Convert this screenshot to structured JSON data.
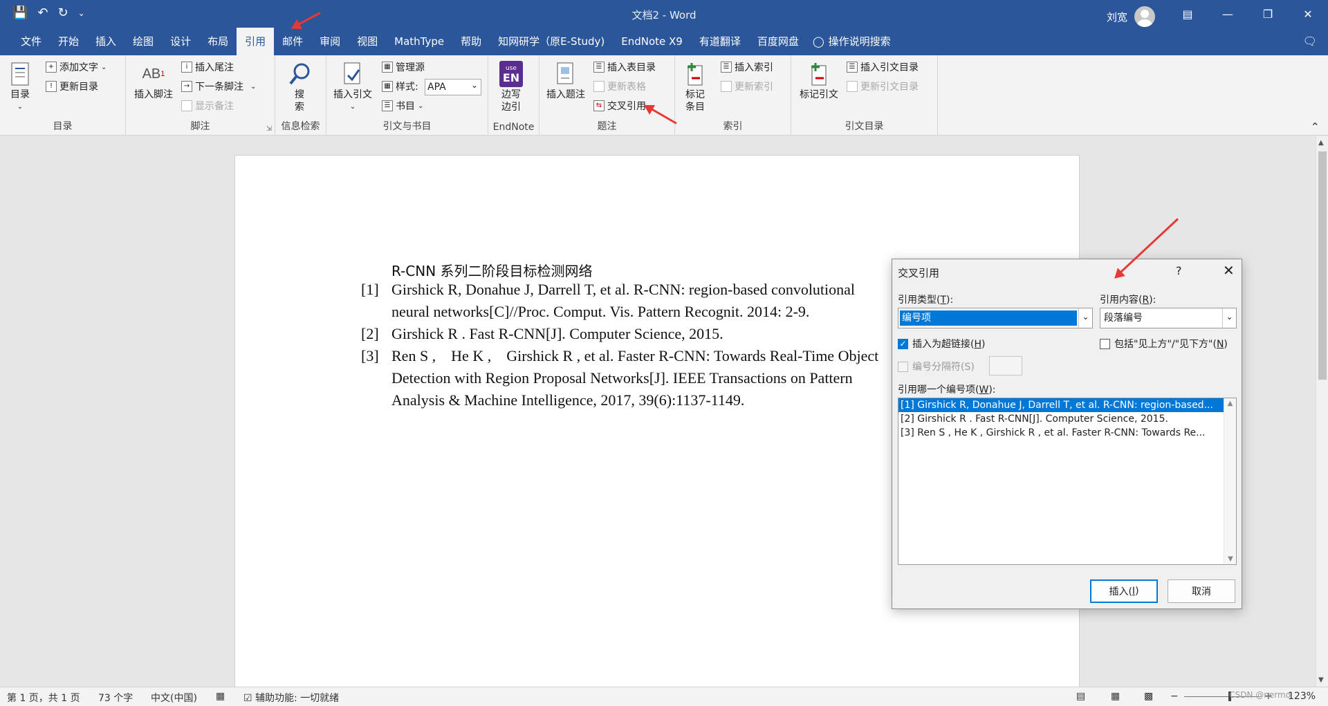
{
  "title": {
    "doc_name": "文档2",
    "sep": " - ",
    "app": "Word",
    "user": "刘宽"
  },
  "tabs": [
    "文件",
    "开始",
    "插入",
    "绘图",
    "设计",
    "布局",
    "引用",
    "邮件",
    "审阅",
    "视图",
    "MathType",
    "帮助",
    "知网研学（原E-Study)",
    "EndNote X9",
    "有道翻译",
    "百度网盘"
  ],
  "tell_me": "操作说明搜索",
  "ribbon": {
    "toc": {
      "big": "目录",
      "add_text": "添加文字",
      "update": "更新目录",
      "label": "目录"
    },
    "footnotes": {
      "big": "插入脚注",
      "insert_endnote": "插入尾注",
      "next_footnote": "下一条脚注",
      "show_notes": "显示备注",
      "label": "脚注"
    },
    "research": {
      "big_line1": "搜",
      "big_line2": "索",
      "label": "信息检索"
    },
    "citations": {
      "big": "插入引文",
      "manage": "管理源",
      "style_label": "样式:",
      "style_value": "APA",
      "bibliography": "书目",
      "label": "引文与书目"
    },
    "endnote": {
      "logo_top": "use",
      "logo_main": "EN",
      "big_line1": "边写",
      "big_line2": "边引",
      "label": "EndNote"
    },
    "captions": {
      "big": "插入题注",
      "insert_table_figures": "插入表目录",
      "update_table": "更新表格",
      "cross_ref": "交叉引用",
      "label": "题注"
    },
    "index": {
      "big_line1": "标记",
      "big_line2": "条目",
      "insert_index": "插入索引",
      "update_index": "更新索引",
      "label": "索引"
    },
    "toa": {
      "big": "标记引文",
      "insert_toa": "插入引文目录",
      "update_toa": "更新引文目录",
      "label": "引文目录"
    }
  },
  "document": {
    "caption": "R-CNN 系列二阶段目标检测网络",
    "refs": [
      {
        "num": "[1]",
        "line1": "Girshick R, Donahue J, Darrell T, et al. R-CNN: region-based convolutional",
        "line2": "neural networks[C]//Proc. Comput. Vis. Pattern Recognit. 2014: 2-9."
      },
      {
        "num": "[2]",
        "line1": "Girshick R . Fast R-CNN[J]. Computer Science, 2015.",
        "line2": ""
      },
      {
        "num": "[3]",
        "line1": "Ren S ,    He K ,    Girshick R , et al. Faster R-CNN: Towards Real-Time Object",
        "line2": "Detection with Region Proposal Networks[J]. IEEE Transactions on Pattern",
        "line3": "Analysis & Machine Intelligence, 2017, 39(6):1137-1149."
      }
    ]
  },
  "dialog": {
    "title": "交叉引用",
    "help": "?",
    "ref_type_label": "引用类型(",
    "ref_type_key": "T",
    "ref_type_value": "编号项",
    "ref_content_label": "引用内容(",
    "ref_content_key": "R",
    "ref_content_value": "段落编号",
    "hyperlink": "插入为超链接(",
    "hyperlink_key": "H",
    "above_below": "包括\"见上方\"/\"见下方\"(",
    "above_below_key": "N",
    "separator": "编号分隔符(S)",
    "which_label": "引用哪一个编号项(",
    "which_key": "W",
    "items": [
      "[1]  Girshick R, Donahue J, Darrell T, et al. R-CNN: region-based...",
      "[2]  Girshick R . Fast R-CNN[J]. Computer Science, 2015.",
      "[3]  Ren S ,  He K ,  Girshick R , et al. Faster R-CNN: Towards Re..."
    ],
    "insert": "插入(",
    "insert_key": "I",
    "cancel": "取消"
  },
  "status": {
    "page": "第 1 页，共 1 页",
    "words": "73 个字",
    "lang": "中文(中国)",
    "accessibility": "辅助功能: 一切就绪",
    "zoom": "123%",
    "watermark": "CSDN @nermo"
  }
}
